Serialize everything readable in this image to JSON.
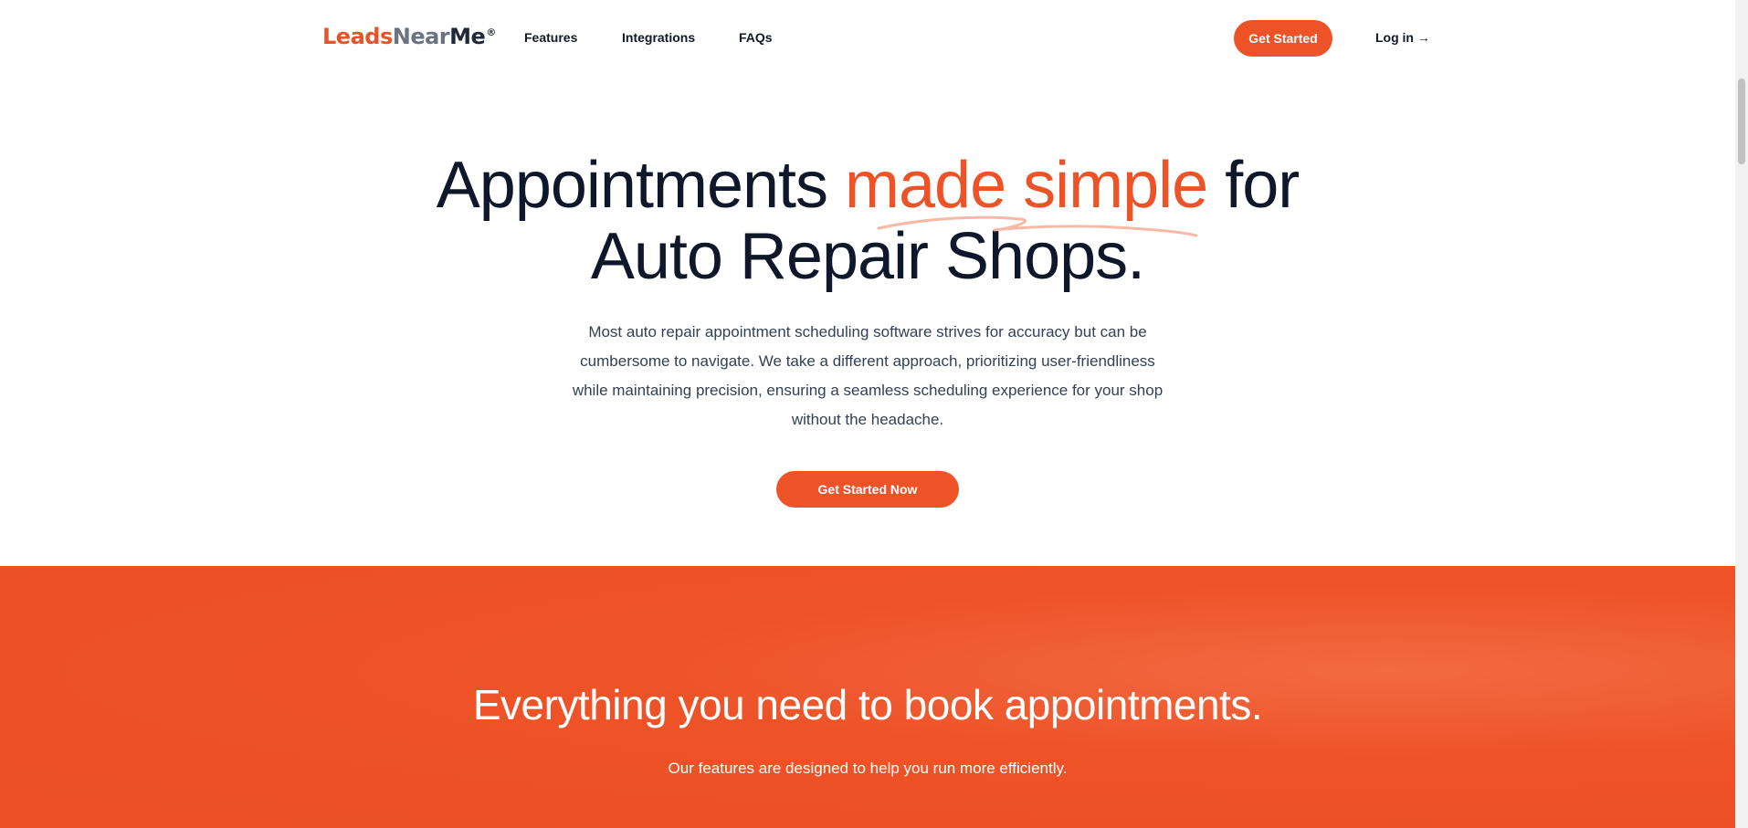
{
  "nav": {
    "logo": {
      "part1": "Leads",
      "part2": "Near",
      "part3": "Me",
      "mark": "®"
    },
    "links": [
      "Features",
      "Integrations",
      "FAQs"
    ],
    "get_started": "Get Started",
    "login": "Log in →"
  },
  "hero": {
    "title_before": "Appointments ",
    "title_accent": "made simple",
    "title_after": " for",
    "title_line2": "Auto Repair Shops.",
    "subtitle": "Most auto repair appointment scheduling software strives for accuracy but can be cumbersome to navigate. We take a different approach, prioritizing user-friendliness while maintaining precision, ensuring a seamless scheduling experience for your shop without the headache.",
    "cta": "Get Started Now"
  },
  "features": {
    "title": "Everything you need to book appointments.",
    "subtitle": "Our features are designed to help you run more efficiently."
  },
  "colors": {
    "accent": "#ee5227",
    "text_dark": "#0f172a"
  }
}
